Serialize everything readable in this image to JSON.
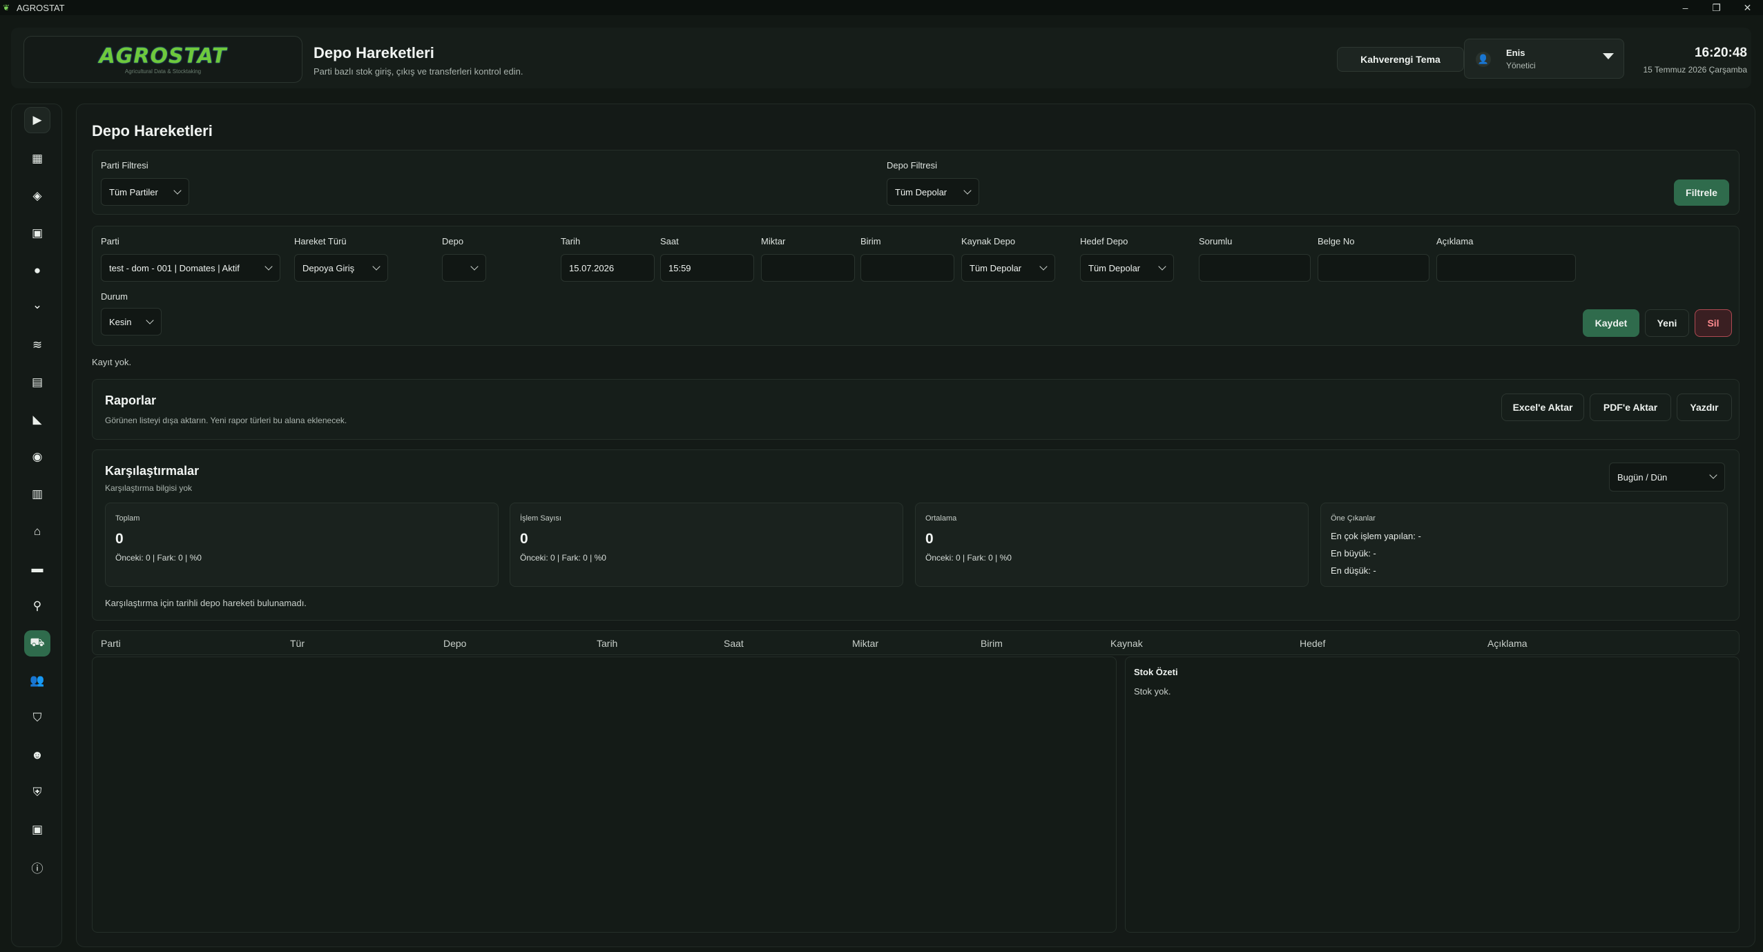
{
  "window": {
    "title": "AGROSTAT"
  },
  "header": {
    "logo_text": "AGROSTAT",
    "logo_sub": "Agricultural Data & Stocktaking",
    "page_title": "Depo Hareketleri",
    "page_subtitle": "Parti bazlı stok giriş, çıkış ve transferleri kontrol edin.",
    "theme_button": "Kahverengi Tema",
    "user": {
      "name": "Enis",
      "role": "Yönetici"
    },
    "clock": {
      "time": "16:20:48",
      "date": "15 Temmuz 2026 Çarşamba"
    }
  },
  "sidebar": {
    "icons": [
      "chevron-right-icon",
      "dashboard-icon",
      "layers-icon",
      "inventory-icon",
      "location-pin-icon",
      "chevron-down-icon",
      "stack-icon",
      "document-icon",
      "chart-icon",
      "box-icon",
      "calendar-icon",
      "warehouse-icon",
      "folder-icon",
      "pin-icon",
      "truck-icon",
      "users-icon",
      "cart-icon",
      "group-icon",
      "shield-icon",
      "save-icon",
      "info-icon"
    ],
    "active_index": 14
  },
  "main": {
    "title": "Depo Hareketleri",
    "filters": {
      "parti_label": "Parti Filtresi",
      "parti_value": "Tüm Partiler",
      "depo_label": "Depo Filtresi",
      "depo_value": "Tüm Depolar",
      "filter_button": "Filtrele"
    },
    "form": {
      "parti": {
        "label": "Parti",
        "value": "test - dom - 001 | Domates | Aktif"
      },
      "hareket": {
        "label": "Hareket Türü",
        "value": "Depoya Giriş"
      },
      "depo": {
        "label": "Depo",
        "value": ""
      },
      "tarih": {
        "label": "Tarih",
        "value": "15.07.2026"
      },
      "saat": {
        "label": "Saat",
        "value": "15:59"
      },
      "miktar": {
        "label": "Miktar",
        "value": ""
      },
      "birim": {
        "label": "Birim",
        "value": ""
      },
      "kaynak": {
        "label": "Kaynak Depo",
        "value": "Tüm Depolar"
      },
      "hedef": {
        "label": "Hedef Depo",
        "value": "Tüm Depolar"
      },
      "sorumlu": {
        "label": "Sorumlu",
        "value": ""
      },
      "belge": {
        "label": "Belge No",
        "value": ""
      },
      "aciklama": {
        "label": "Açıklama",
        "value": ""
      },
      "durum": {
        "label": "Durum",
        "value": "Kesin"
      },
      "save_button": "Kaydet",
      "new_button": "Yeni",
      "delete_button": "Sil"
    },
    "empty_note": "Kayıt yok.",
    "reports": {
      "title": "Raporlar",
      "subtitle": "Görünen listeyi dışa aktarın. Yeni rapor türleri bu alana eklenecek.",
      "excel_button": "Excel'e Aktar",
      "pdf_button": "PDF'e Aktar",
      "print_button": "Yazdır"
    },
    "comparisons": {
      "title": "Karşılaştırmalar",
      "subtitle": "Karşılaştırma bilgisi yok",
      "period": "Bugün / Dün",
      "cards": [
        {
          "title": "Toplam",
          "value": "0",
          "prev": "Önceki: 0 | Fark: 0 | %0"
        },
        {
          "title": "İşlem Sayısı",
          "value": "0",
          "prev": "Önceki: 0 | Fark: 0 | %0"
        },
        {
          "title": "Ortalama",
          "value": "0",
          "prev": "Önceki: 0 | Fark: 0 | %0"
        }
      ],
      "highlights": {
        "title": "Öne Çıkanlar",
        "lines": [
          "En çok işlem yapılan: -",
          "En büyük: -",
          "En düşük: -"
        ]
      },
      "footer_note": "Karşılaştırma için tarihli depo hareketi bulunamadı."
    },
    "table": {
      "columns": [
        "Parti",
        "Tür",
        "Depo",
        "Tarih",
        "Saat",
        "Miktar",
        "Birim",
        "Kaynak",
        "Hedef",
        "Açıklama"
      ]
    },
    "stock_summary": {
      "title": "Stok Özeti",
      "empty": "Stok yok."
    }
  },
  "colors": {
    "accent": "#2f6b4c",
    "danger": "#b04a52",
    "background": "#121814"
  }
}
